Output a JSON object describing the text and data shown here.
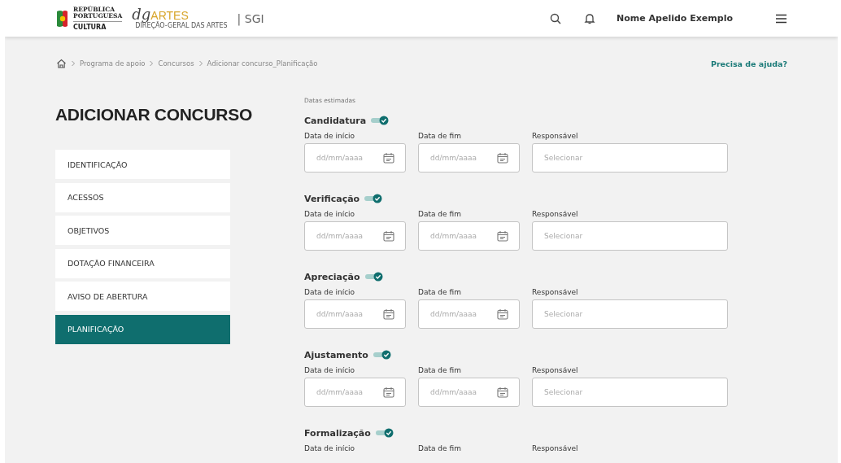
{
  "header": {
    "logo_top": "REPÚBLICA\nPORTUGUESA",
    "logo_sub": "CULTURA",
    "brand_dg": "dg",
    "brand_artes": "ARTES",
    "brand_sub": "DIREÇÃO-GERAL DAS ARTES",
    "app": "| SGI",
    "user": "Nome Apelido Exemplo"
  },
  "breadcrumb": [
    "Programa de apoio",
    "Concursos",
    "Adicionar concurso_Planificação"
  ],
  "help_link": "Precisa de ajuda?",
  "page_title": "ADICIONAR CONCURSO",
  "sidebar": {
    "items": [
      {
        "label": "IDENTIFICAÇÃO",
        "selected": false
      },
      {
        "label": "ACESSOS",
        "selected": false
      },
      {
        "label": "OBJETIVOS",
        "selected": false
      },
      {
        "label": "DOTAÇÃO FINANCEIRA",
        "selected": false
      },
      {
        "label": "AVISO DE ABERTURA",
        "selected": false
      },
      {
        "label": "PLANIFICAÇÃO",
        "selected": true
      }
    ]
  },
  "form": {
    "caption": "Datas estimadas",
    "sections": [
      {
        "title": "Candidatura",
        "on": true,
        "start_label": "Data de início",
        "start_placeholder": "dd/mm/aaaa",
        "end_label": "Data de fim",
        "end_placeholder": "dd/mm/aaaa",
        "responsible_label": "Responsável",
        "responsible_placeholder": "Selecionar"
      },
      {
        "title": "Verificação",
        "on": true,
        "start_label": "Data de início",
        "start_placeholder": "dd/mm/aaaa",
        "end_label": "Data de fim",
        "end_placeholder": "dd/mm/aaaa",
        "responsible_label": "Responsável",
        "responsible_placeholder": "Selecionar"
      },
      {
        "title": "Apreciação",
        "on": true,
        "start_label": "Data de início",
        "start_placeholder": "dd/mm/aaaa",
        "end_label": "Data de fim",
        "end_placeholder": "dd/mm/aaaa",
        "responsible_label": "Responsável",
        "responsible_placeholder": "Selecionar"
      },
      {
        "title": "Ajustamento",
        "on": true,
        "start_label": "Data de início",
        "start_placeholder": "dd/mm/aaaa",
        "end_label": "Data de fim",
        "end_placeholder": "dd/mm/aaaa",
        "responsible_label": "Responsável",
        "responsible_placeholder": "Selecionar"
      },
      {
        "title": "Formalização",
        "on": true,
        "start_label": "Data de início",
        "end_label": "Data de fim",
        "responsible_label": "Responsável"
      }
    ]
  }
}
